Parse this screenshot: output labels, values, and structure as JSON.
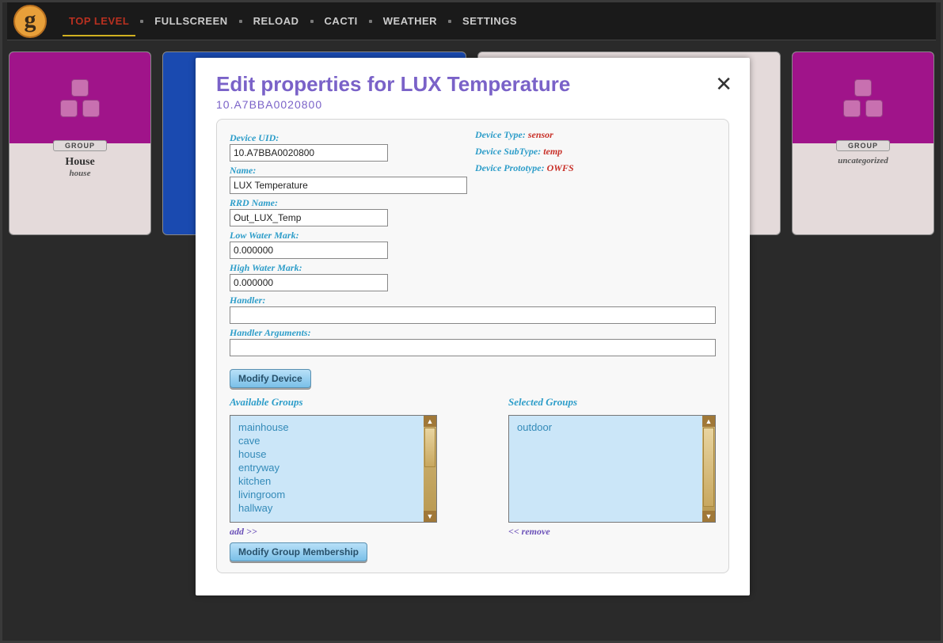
{
  "nav": {
    "items": [
      "TOP LEVEL",
      "FULLSCREEN",
      "RELOAD",
      "CACTI",
      "WEATHER",
      "SETTINGS"
    ],
    "active_index": 0
  },
  "cards": {
    "group_badge": "GROUP",
    "left": {
      "title": "House",
      "sub": "house"
    },
    "right": {
      "title": "uncategorized"
    }
  },
  "modal": {
    "title": "Edit properties for LUX Temperature",
    "subtitle": "10.A7BBA0020800",
    "labels": {
      "device_uid": "Device UID:",
      "name": "Name:",
      "rrd_name": "RRD Name:",
      "low_water": "Low Water Mark:",
      "high_water": "High Water Mark:",
      "handler": "Handler:",
      "handler_args": "Handler Arguments:",
      "device_type": "Device Type:",
      "device_subtype": "Device SubType:",
      "device_proto": "Device Prototype:",
      "available": "Available Groups",
      "selected": "Selected Groups"
    },
    "values": {
      "device_uid": "10.A7BBA0020800",
      "name": "LUX Temperature",
      "rrd_name": "Out_LUX_Temp",
      "low_water": "0.000000",
      "high_water": "0.000000",
      "handler": "",
      "handler_args": "",
      "device_type": "sensor",
      "device_subtype": "temp",
      "device_proto": "OWFS"
    },
    "buttons": {
      "modify_device": "Modify Device",
      "modify_group": "Modify Group Membership"
    },
    "links": {
      "add": "add >>",
      "remove": "<< remove"
    },
    "available_groups": [
      "mainhouse",
      "cave",
      "house",
      "entryway",
      "kitchen",
      "livingroom",
      "hallway"
    ],
    "selected_groups": [
      "outdoor"
    ]
  }
}
